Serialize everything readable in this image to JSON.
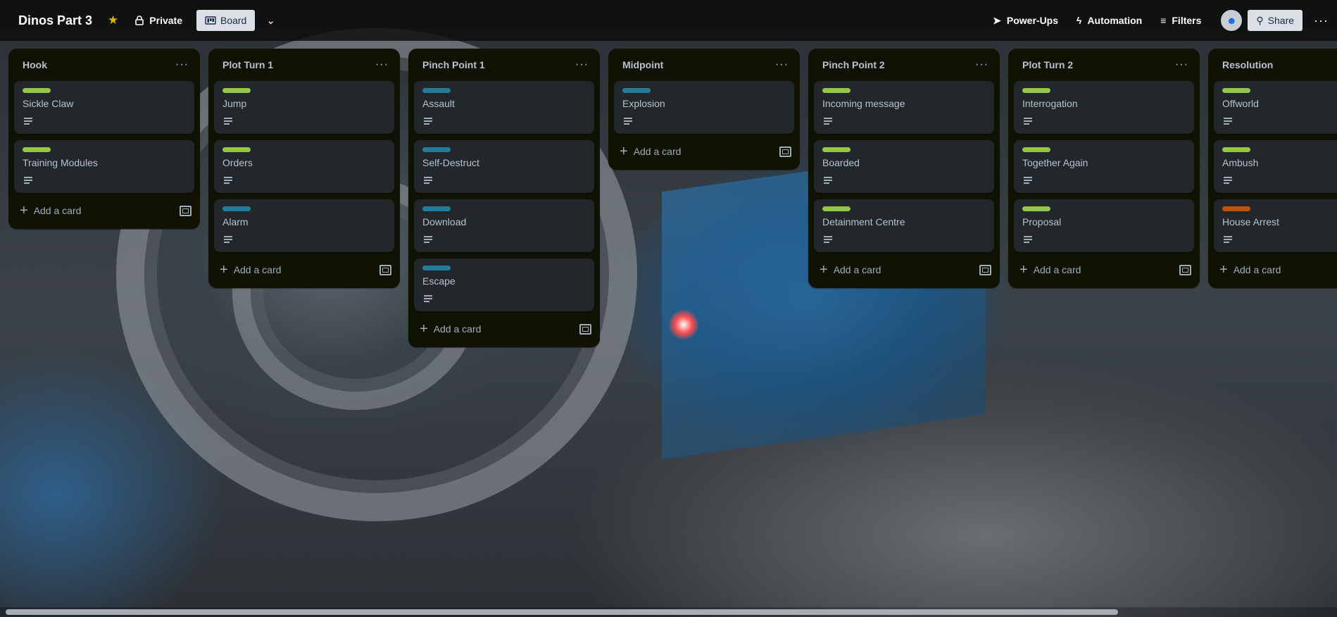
{
  "board": {
    "title": "Dinos Part 3",
    "visibility": "Private",
    "view": "Board"
  },
  "toolbar": {
    "powerups": "Power-Ups",
    "automation": "Automation",
    "filters": "Filters",
    "share": "Share"
  },
  "icons": {
    "star": "star-icon",
    "lock": "lock-icon",
    "board": "board-icon",
    "chevron": "chevron-down-icon",
    "rocket": "rocket-icon",
    "bolt": "bolt-icon",
    "filter": "filter-icon",
    "more": "more-icon",
    "template": "template-icon",
    "description": "description-icon"
  },
  "colors": {
    "green": "#94c748",
    "blue": "#227d9b",
    "orange": "#c25100"
  },
  "lists": [
    {
      "title": "Hook",
      "add_label": "Add a card",
      "cards": [
        {
          "title": "Sickle Claw",
          "label": "green"
        },
        {
          "title": "Training Modules",
          "label": "green"
        }
      ]
    },
    {
      "title": "Plot Turn 1",
      "add_label": "Add a card",
      "cards": [
        {
          "title": "Jump",
          "label": "green"
        },
        {
          "title": "Orders",
          "label": "green"
        },
        {
          "title": "Alarm",
          "label": "blue"
        }
      ]
    },
    {
      "title": "Pinch Point 1",
      "add_label": "Add a card",
      "cards": [
        {
          "title": "Assault",
          "label": "blue"
        },
        {
          "title": "Self-Destruct",
          "label": "blue"
        },
        {
          "title": "Download",
          "label": "blue"
        },
        {
          "title": "Escape",
          "label": "blue"
        }
      ]
    },
    {
      "title": "Midpoint",
      "add_label": "Add a card",
      "cards": [
        {
          "title": "Explosion",
          "label": "blue"
        }
      ]
    },
    {
      "title": "Pinch Point 2",
      "add_label": "Add a card",
      "cards": [
        {
          "title": "Incoming message",
          "label": "green"
        },
        {
          "title": "Boarded",
          "label": "green"
        },
        {
          "title": "Detainment Centre",
          "label": "green"
        }
      ]
    },
    {
      "title": "Plot Turn 2",
      "add_label": "Add a card",
      "cards": [
        {
          "title": "Interrogation",
          "label": "green"
        },
        {
          "title": "Together Again",
          "label": "green"
        },
        {
          "title": "Proposal",
          "label": "green"
        }
      ]
    },
    {
      "title": "Resolution",
      "add_label": "Add a card",
      "cards": [
        {
          "title": "Offworld",
          "label": "green"
        },
        {
          "title": "Ambush",
          "label": "green"
        },
        {
          "title": "House Arrest",
          "label": "orange"
        }
      ]
    }
  ]
}
